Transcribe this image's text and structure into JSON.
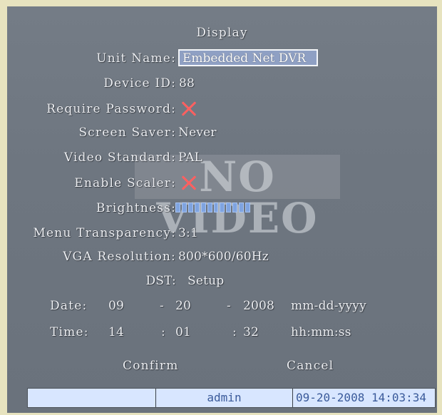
{
  "title": "Display",
  "unit_name": {
    "label": "Unit Name:",
    "value": "Embedded Net DVR"
  },
  "device_id": {
    "label": "Device ID:",
    "value": "88"
  },
  "require_password": {
    "label": "Require Password:"
  },
  "screen_saver": {
    "label": "Screen Saver:",
    "value": "Never"
  },
  "video_standard": {
    "label": "Video Standard:",
    "value": "PAL"
  },
  "enable_scaler": {
    "label": "Enable Scaler:"
  },
  "brightness": {
    "label": "Brightness:",
    "level": 1.0
  },
  "menu_transparency": {
    "label": "Menu Transparency:",
    "value": "3:1"
  },
  "vga_resolution": {
    "label": "VGA Resolution:",
    "value": "800*600/60Hz"
  },
  "dst": {
    "label": "DST:",
    "value": "Setup"
  },
  "date": {
    "label": "Date:",
    "month": "09",
    "sep1": "-",
    "day": "20",
    "sep2": "-",
    "year": "2008",
    "format": "mm-dd-yyyy"
  },
  "time": {
    "label": "Time:",
    "hour": "14",
    "sep1": ":",
    "minute": "01",
    "sep2": ":",
    "second": "32",
    "format": "hh:mm:ss"
  },
  "buttons": {
    "confirm": "Confirm",
    "cancel": "Cancel"
  },
  "overlay": {
    "no_video": "NO VIDEO"
  },
  "status_bar": {
    "user": "admin",
    "datetime": "09-20-2008 14:03:34"
  },
  "colors": {
    "panel": "#6e7680",
    "text": "#eef0f4",
    "disabled_x": "#ff6060",
    "status_bar": "#d8e6ff",
    "highlight": "#8fa0c4"
  }
}
